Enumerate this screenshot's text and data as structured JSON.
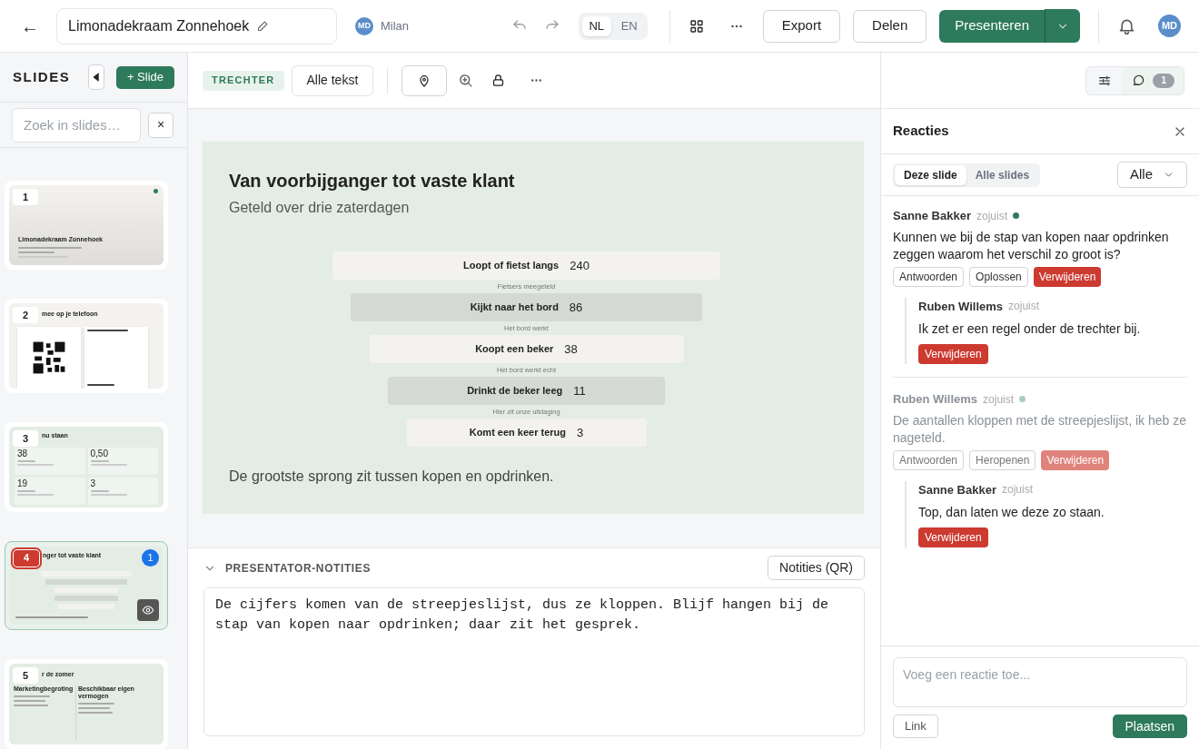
{
  "topbar": {
    "back": "←",
    "title": "Limonadekraam Zonnehoek",
    "user": {
      "initials": "MD",
      "name": "Milan"
    },
    "languages": [
      {
        "label": "NL",
        "selected": true
      },
      {
        "label": "EN",
        "selected": false
      }
    ],
    "buttons": [
      "Export",
      "Delen"
    ],
    "present": "Presenteren",
    "avatar": "MD"
  },
  "sidebar": {
    "heading": "SLIDES",
    "add": "+ Slide",
    "search": {
      "placeholder": "Zoek in slides…"
    },
    "clear": "×",
    "slides": [
      {
        "number": "1",
        "kind": "title",
        "title": "Limonadekraam Zonnehoek",
        "selected": false,
        "published": true
      },
      {
        "number": "2",
        "kind": "qr",
        "title": "mee op je telefoon",
        "selected": false,
        "published": false
      },
      {
        "number": "3",
        "kind": "stats",
        "title": "nu staan",
        "stats": [
          "38",
          "0,50",
          "19",
          "3"
        ],
        "selected": false,
        "published": false
      },
      {
        "number": "4",
        "kind": "funnel",
        "title": "nger tot vaste klant",
        "selected": true,
        "published": false,
        "comments": "1"
      },
      {
        "number": "5",
        "kind": "columns",
        "title": "r de zomer",
        "columns": [
          "Marketingbegroting",
          "Beschikbaar eigen vermogen"
        ],
        "selected": false,
        "published": false
      }
    ]
  },
  "toolbar": {
    "layout": "TRECHTER",
    "text_button": "Alle tekst",
    "comment_count": "1"
  },
  "slide": {
    "title": "Van voorbijganger tot vaste klant",
    "subtitle": "Geteld over drie zaterdagen",
    "steps": [
      {
        "label": "Loopt of fietst langs",
        "value": "240",
        "note": "Fietsers meegeteld"
      },
      {
        "label": "Kijkt naar het bord",
        "value": "86",
        "note": "Het bord werkt"
      },
      {
        "label": "Koopt een beker",
        "value": "38",
        "note": "Het bord werkt echt"
      },
      {
        "label": "Drinkt de beker leeg",
        "value": "11",
        "note": "Hier zit onze uitdaging"
      },
      {
        "label": "Komt een keer terug",
        "value": "3"
      }
    ],
    "footer": "De grootste sprong zit tussen kopen en opdrinken."
  },
  "notes": {
    "heading": "PRESENTATOR-NOTITIES",
    "qr_button": "Notities (QR)",
    "text": "De cijfers komen van de streepjeslijst, dus ze kloppen. Blijf hangen bij de stap van kopen naar opdrinken; daar zit het gesprek."
  },
  "comments": {
    "title": "Reacties",
    "tabs": [
      {
        "label": "Deze slide",
        "selected": true
      },
      {
        "label": "Alle slides",
        "selected": false
      }
    ],
    "filter": "Alle",
    "threads": [
      {
        "author": "Sanne Bakker",
        "time": "zojuist",
        "resolved": false,
        "text": "Kunnen we bij de stap van kopen naar opdrinken zeggen waarom het verschil zo groot is?",
        "actions": [
          "Antwoorden",
          "Oplossen",
          "Verwijderen"
        ],
        "replies": [
          {
            "author": "Ruben Willems",
            "time": "zojuist",
            "text": "Ik zet er een regel onder de trechter bij.",
            "delete": "Verwijderen"
          }
        ]
      },
      {
        "author": "Ruben Willems",
        "time": "zojuist",
        "resolved": true,
        "text": "De aantallen kloppen met de streepjeslijst, ik heb ze nageteld.",
        "actions": [
          "Antwoorden",
          "Heropenen",
          "Verwijderen"
        ],
        "replies": [
          {
            "author": "Sanne Bakker",
            "time": "zojuist",
            "text": "Top, dan laten we deze zo staan.",
            "delete": "Verwijderen"
          }
        ]
      }
    ],
    "input": {
      "placeholder": "Voeg een reactie toe..."
    },
    "link": "Link",
    "post": "Plaatsen"
  }
}
